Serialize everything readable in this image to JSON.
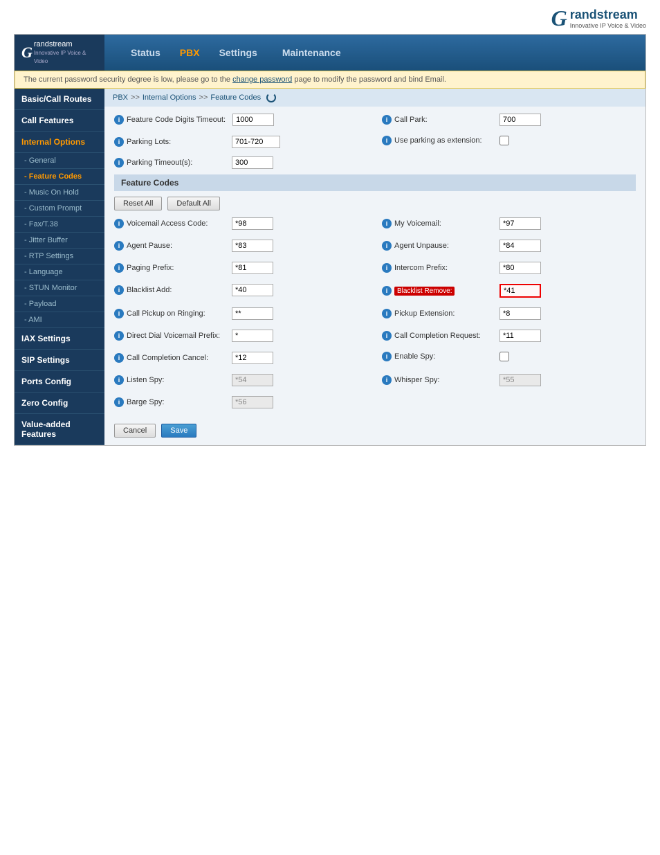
{
  "topbar": {
    "logo_g": "G",
    "logo_brand": "randstream",
    "logo_slogan": "Innovative IP Voice & Video"
  },
  "header": {
    "logo_g": "G",
    "logo_text": "randstream",
    "logo_sub": "Innovative IP Voice & Video",
    "nav": [
      {
        "label": "Status",
        "id": "status",
        "active": false
      },
      {
        "label": "PBX",
        "id": "pbx",
        "active": true,
        "special": true
      },
      {
        "label": "Settings",
        "id": "settings",
        "active": false
      },
      {
        "label": "Maintenance",
        "id": "maintenance",
        "active": false
      }
    ]
  },
  "alert": {
    "text": "The current password security degree is low, please go to the ",
    "link_text": "change password",
    "text2": " page to modify the password and bind Email."
  },
  "sidebar": {
    "sections": [
      {
        "label": "Basic/Call Routes",
        "id": "basic-call-routes",
        "type": "section",
        "orange": false
      },
      {
        "label": "Call Features",
        "id": "call-features",
        "type": "section",
        "orange": false
      },
      {
        "label": "Internal Options",
        "id": "internal-options",
        "type": "section",
        "orange": true
      },
      {
        "label": "- General",
        "id": "general",
        "type": "item",
        "active": false
      },
      {
        "label": "- Feature Codes",
        "id": "feature-codes",
        "type": "item",
        "active": true
      },
      {
        "label": "- Music On Hold",
        "id": "music-on-hold",
        "type": "item",
        "active": false
      },
      {
        "label": "- Custom Prompt",
        "id": "custom-prompt",
        "type": "item",
        "active": false
      },
      {
        "label": "- Fax/T.38",
        "id": "fax-t38",
        "type": "item",
        "active": false
      },
      {
        "label": "- Jitter Buffer",
        "id": "jitter-buffer",
        "type": "item",
        "active": false
      },
      {
        "label": "- RTP Settings",
        "id": "rtp-settings",
        "type": "item",
        "active": false
      },
      {
        "label": "- Language",
        "id": "language",
        "type": "item",
        "active": false
      },
      {
        "label": "- STUN Monitor",
        "id": "stun-monitor",
        "type": "item",
        "active": false
      },
      {
        "label": "- Payload",
        "id": "payload",
        "type": "item",
        "active": false
      },
      {
        "label": "- AMI",
        "id": "ami",
        "type": "item",
        "active": false
      },
      {
        "label": "IAX Settings",
        "id": "iax-settings",
        "type": "section",
        "orange": false
      },
      {
        "label": "SIP Settings",
        "id": "sip-settings",
        "type": "section",
        "orange": false
      },
      {
        "label": "Ports Config",
        "id": "ports-config",
        "type": "section",
        "orange": false
      },
      {
        "label": "Zero Config",
        "id": "zero-config",
        "type": "section",
        "orange": false
      },
      {
        "label": "Value-added Features",
        "id": "value-added-features",
        "type": "section",
        "orange": false
      }
    ]
  },
  "breadcrumb": {
    "items": [
      "PBX",
      "Internal Options",
      "Feature Codes"
    ]
  },
  "top_fields": {
    "left": {
      "label": "Feature Code Digits Timeout:",
      "value": "1000"
    },
    "right": {
      "label": "Call Park:",
      "value": "700"
    }
  },
  "parking": {
    "lots_label": "Parking Lots:",
    "lots_value": "701-720",
    "use_as_ext_label": "Use parking as extension:",
    "use_as_ext_checked": false,
    "timeout_label": "Parking Timeout(s):",
    "timeout_value": "300"
  },
  "feature_codes": {
    "section_title": "Feature Codes",
    "reset_btn": "Reset All",
    "default_btn": "Default All",
    "fields": [
      {
        "left_label": "Voicemail Access Code:",
        "left_value": "*98",
        "right_label": "My Voicemail:",
        "right_value": "*97"
      },
      {
        "left_label": "Agent Pause:",
        "left_value": "*83",
        "right_label": "Agent Unpause:",
        "right_value": "*84"
      },
      {
        "left_label": "Paging Prefix:",
        "left_value": "*81",
        "right_label": "Intercom Prefix:",
        "right_value": "*80"
      },
      {
        "left_label": "Blacklist Add:",
        "left_value": "*40",
        "right_label": "Blacklist Remove:",
        "right_value": "*41",
        "right_highlighted": true
      },
      {
        "left_label": "Call Pickup on Ringing:",
        "left_value": "**",
        "right_label": "Pickup Extension:",
        "right_value": "*8"
      },
      {
        "left_label": "Direct Dial Voicemail Prefix:",
        "left_value": "*",
        "right_label": "Call Completion Request:",
        "right_value": "*11"
      },
      {
        "left_label": "Call Completion Cancel:",
        "left_value": "*12",
        "right_label": "Enable Spy:",
        "right_value": "",
        "right_checkbox": true
      },
      {
        "left_label": "Listen Spy:",
        "left_value": "*54",
        "left_disabled": true,
        "right_label": "Whisper Spy:",
        "right_value": "*55",
        "right_disabled": true
      },
      {
        "left_label": "Barge Spy:",
        "left_value": "*56",
        "left_disabled": true
      }
    ]
  },
  "buttons": {
    "cancel": "Cancel",
    "save": "Save"
  }
}
